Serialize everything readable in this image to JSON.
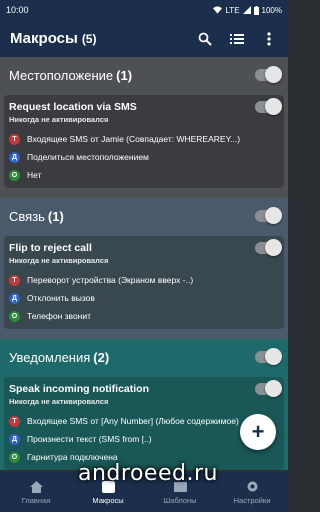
{
  "status_bar": {
    "time": "10:00",
    "network": "LTE",
    "battery": "100%"
  },
  "app_bar": {
    "title": "Макросы",
    "count": "(5)"
  },
  "categories": [
    {
      "title": "Местоположение",
      "count": "(1)",
      "macro": {
        "name": "Request location via SMS",
        "status": "Никогда не активировался",
        "lines": [
          {
            "badge": "T",
            "text": "Входящее SMS от Jamie (Совпадает: WHEREAREY...)"
          },
          {
            "badge": "Д",
            "text": "Поделиться местоположением"
          },
          {
            "badge": "О",
            "text": "Нет"
          }
        ]
      }
    },
    {
      "title": "Связь",
      "count": "(1)",
      "macro": {
        "name": "Flip to reject call",
        "status": "Никогда не активировался",
        "lines": [
          {
            "badge": "T",
            "text": "Переворот устройства (Экраном вверх -..)"
          },
          {
            "badge": "Д",
            "text": "Отклонить вызов"
          },
          {
            "badge": "О",
            "text": "Телефон звонит"
          }
        ]
      }
    },
    {
      "title": "Уведомления",
      "count": "(2)",
      "macro": {
        "name": "Speak incoming notification",
        "status": "Никогда не активировался",
        "lines": [
          {
            "badge": "T",
            "text": "Входящее SMS от [Any Number] (Любое содержимое)"
          },
          {
            "badge": "Д",
            "text": "Произнести текст (SMS from [..)"
          },
          {
            "badge": "О",
            "text": "Гарнитура подключена"
          }
        ]
      }
    }
  ],
  "bottom_nav": [
    {
      "label": "Главная"
    },
    {
      "label": "Макросы"
    },
    {
      "label": "Шаблоны"
    },
    {
      "label": "Настройки"
    }
  ],
  "watermark": "androeed.ru",
  "icons": {
    "search": "search-icon",
    "list": "list-icon",
    "more": "more-vert-icon",
    "add": "add-icon"
  },
  "colors": {
    "app_bar": "#1b2f4d",
    "cat_location": "#4d5054",
    "cat_connectivity": "#4a5a6a",
    "cat_notifications": "#1e6a6a",
    "trigger": "#c23a3a",
    "action": "#2e62c9",
    "constraint": "#2f8a3a"
  }
}
